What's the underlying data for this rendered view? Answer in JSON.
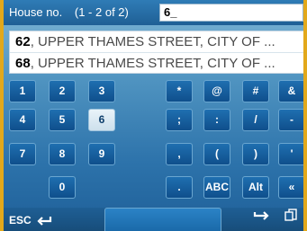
{
  "header": {
    "title": "House no.",
    "count": "(1 - 2 of 2)",
    "input_value": "6_"
  },
  "results": [
    {
      "number": "62",
      "street": ", UPPER THAMES STREET, CITY OF ..."
    },
    {
      "number": "68",
      "street": ", UPPER THAMES STREET, CITY OF ..."
    }
  ],
  "keypad": {
    "k1": "1",
    "k2": "2",
    "k3": "3",
    "k4": "4",
    "k5": "5",
    "k6": "6",
    "k7": "7",
    "k8": "8",
    "k9": "9",
    "k0": "0",
    "s_star": "*",
    "s_at": "@",
    "s_hash": "#",
    "s_amp": "&",
    "s_semicolon": ";",
    "s_colon": ":",
    "s_slash": "/",
    "s_dash": "-",
    "s_comma": ",",
    "s_lparen": "(",
    "s_rparen": ")",
    "s_apos": "'",
    "s_dot": ".",
    "abc": "ABC",
    "alt": "Alt",
    "back": "«"
  },
  "footer": {
    "esc": "ESC"
  },
  "colors": {
    "frame_border": "#e2a81b",
    "key_bg": "#0f4f8c",
    "active_key_bg": "#e9f3f9"
  }
}
